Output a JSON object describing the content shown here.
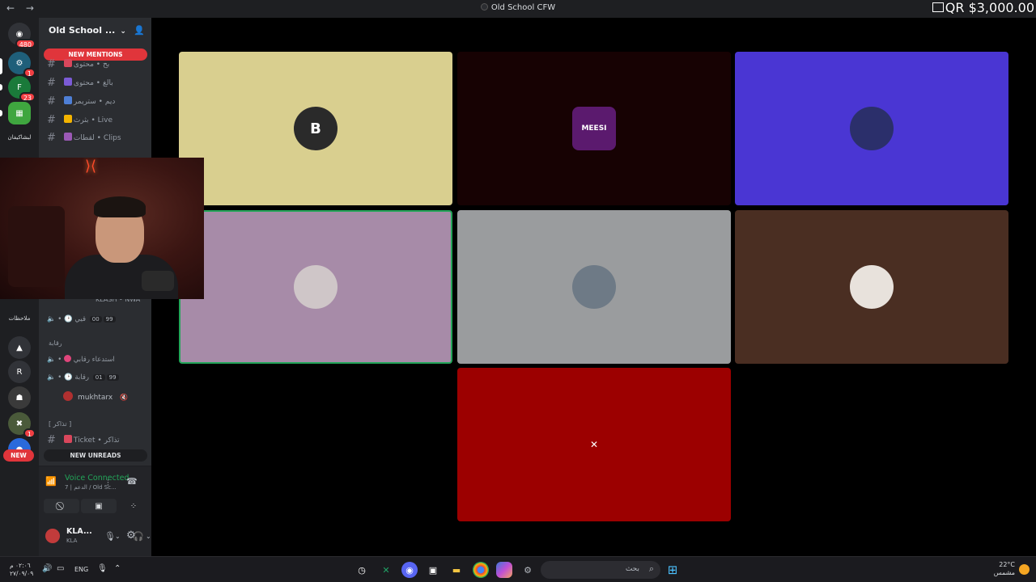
{
  "window": {
    "title": "Old School CFW",
    "back_icon": "←",
    "forward_icon": "→"
  },
  "overlay": {
    "qr_label": "QR",
    "price": "$3,000.00"
  },
  "rail": {
    "dm_badge": "480",
    "badges": [
      "1",
      "23",
      "1"
    ],
    "labels": [
      "لبشاكيفان",
      "ملاحظات"
    ]
  },
  "server": {
    "name": "Old School ...",
    "new_mentions": "NEW MENTIONS",
    "new_unreads": "NEW UNREADS",
    "new_badge": "NEW"
  },
  "channels": [
    {
      "label": "بح • محتوى",
      "emoji_color": "#d9475c"
    },
    {
      "label": "بالغ • محتوى",
      "emoji_color": "#7b5bd6"
    },
    {
      "label": "ديم • ستريمر",
      "emoji_color": "#4e7fd6"
    },
    {
      "label": "بثرث • Live",
      "emoji_color": "#f4b400"
    },
    {
      "label": "لقطات • Clips",
      "emoji_color": "#9b59b6"
    }
  ],
  "voice_rows": [
    {
      "label": "قيي",
      "count_a": "00",
      "count_b": "99"
    },
    {
      "label": "استدعاء رقابي",
      "count_a": "",
      "count_b": ""
    },
    {
      "label": "رقابة",
      "count_a": "01",
      "count_b": "99"
    }
  ],
  "categories": {
    "top_user": "KLASH • NWA",
    "monitoring": "رقابة",
    "tickets": "[ تذاكر ]"
  },
  "voice_user": "mukhtarx",
  "ticket_channel": "Ticket • تذاكر",
  "voice_panel": {
    "status": "Voice Connected",
    "location": "7 | الدعم / Old Sc..."
  },
  "user_panel": {
    "name": "KLA...",
    "sub": "KLA"
  },
  "tiles": [
    {
      "name": "B",
      "bg": "#d9cf8f",
      "av_bg": "#2a2a2a"
    },
    {
      "name": "MEESI",
      "bg": "#170203",
      "av_bg": "#5b1a6e"
    },
    {
      "name": "",
      "bg": "#4a36d3",
      "av_bg": "#2b2f6b"
    },
    {
      "name": "",
      "bg": "#a78ba8",
      "av_bg": "#cfc6c8"
    },
    {
      "name": "",
      "bg": "#9a9c9e",
      "av_bg": "#6e7a86"
    },
    {
      "name": "",
      "bg": "#4a2e22",
      "av_bg": "#e8e2dc"
    },
    {
      "name": "",
      "bg": "#9c0000",
      "av_bg": "#9c0000"
    }
  ],
  "taskbar": {
    "time": "٠٢:٠٦ م",
    "date": "٢٧/٠٩/٠٩",
    "lang": "ENG",
    "search_placeholder": "بحث",
    "temp": "22°C",
    "weather": "مشمس"
  }
}
